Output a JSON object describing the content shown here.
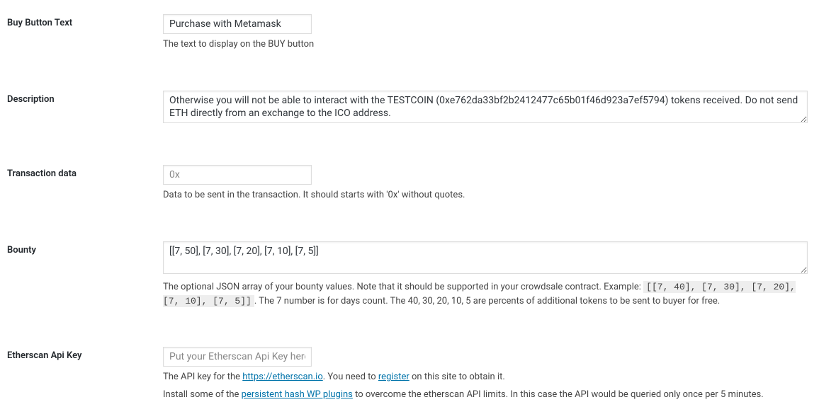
{
  "buyButton": {
    "label": "Buy Button Text",
    "value": "Purchase with Metamask",
    "desc": "The text to display on the BUY button"
  },
  "description": {
    "label": "Description",
    "value": "Otherwise you will not be able to interact with the TESTCOIN (0xe762da33bf2b2412477c65b01f46d923a7ef5794) tokens received. Do not send ETH directly from an exchange to the ICO address."
  },
  "txdata": {
    "label": "Transaction data",
    "placeholder": "0x",
    "desc": "Data to be sent in the transaction. It should starts with '0x' without quotes."
  },
  "bounty": {
    "label": "Bounty",
    "value": "[[7, 50], [7, 30], [7, 20], [7, 10], [7, 5]]",
    "desc1": "The optional JSON array of your bounty values. Note that it should be supported in your crowdsale contract. Example: ",
    "example": "[[7, 40], [7, 30], [7, 20], [7, 10], [7, 5]]",
    "desc2": ". The 7 number is for days count. The 40, 30, 20, 10, 5 are percents of additional tokens to be sent to buyer for free."
  },
  "etherscan": {
    "label": "Etherscan Api Key",
    "placeholder": "Put your Etherscan Api Key here",
    "desc1_a": "The API key for the ",
    "link1": "https://etherscan.io",
    "desc1_b": ". You need to ",
    "link_reg": "register",
    "desc1_c": " on this site to obtain it.",
    "desc2_a": "Install some of the ",
    "link_plugins": "persistent hash WP plugins",
    "desc2_b": " to overcome the etherscan API limits. In this case the API would be queried only once per 5 minutes."
  }
}
